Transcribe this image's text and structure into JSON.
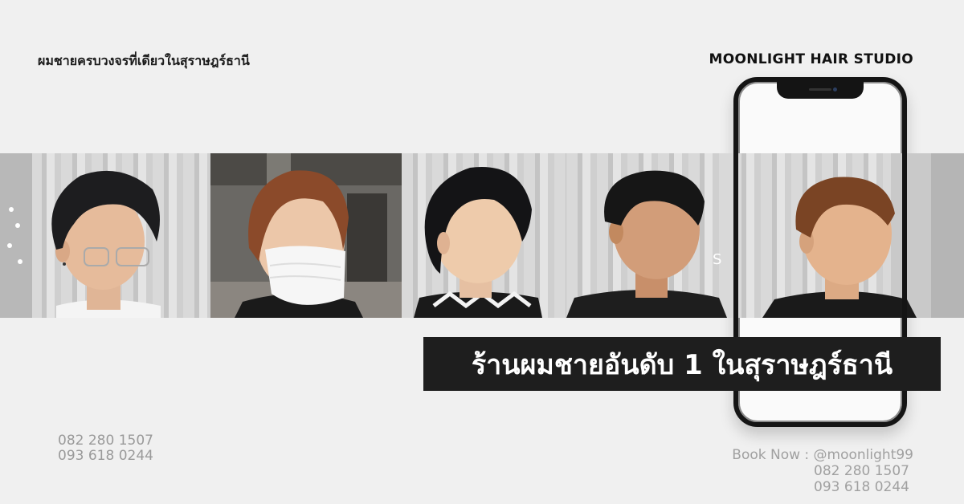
{
  "tagline": "ผมชายครบวงจรที่เดียวในสุราษฎร์ธานี",
  "brand": "MOONLIGHT HAIR STUDIO",
  "headline": "ร้านผมชายอันดับ 1 ในสุราษฎร์ธานี",
  "left_phones": [
    "082 280 1507",
    "093 618 0244"
  ],
  "booking": {
    "label": "Book Now : @moonlight99",
    "phones": [
      "082 280 1507",
      "093 618 0244"
    ]
  },
  "photos": [
    {
      "subject": "man with dark wavy hair and glasses"
    },
    {
      "subject": "person with brown hair wearing face mask"
    },
    {
      "subject": "man with black layered hair in profile"
    },
    {
      "subject": "man with black textured hair smiling"
    },
    {
      "subject": "man with brown textured hair"
    }
  ],
  "colors": {
    "background": "#f0f0f0",
    "headline_bar": "#1e1e1e",
    "muted_text": "#9a9a9a"
  }
}
